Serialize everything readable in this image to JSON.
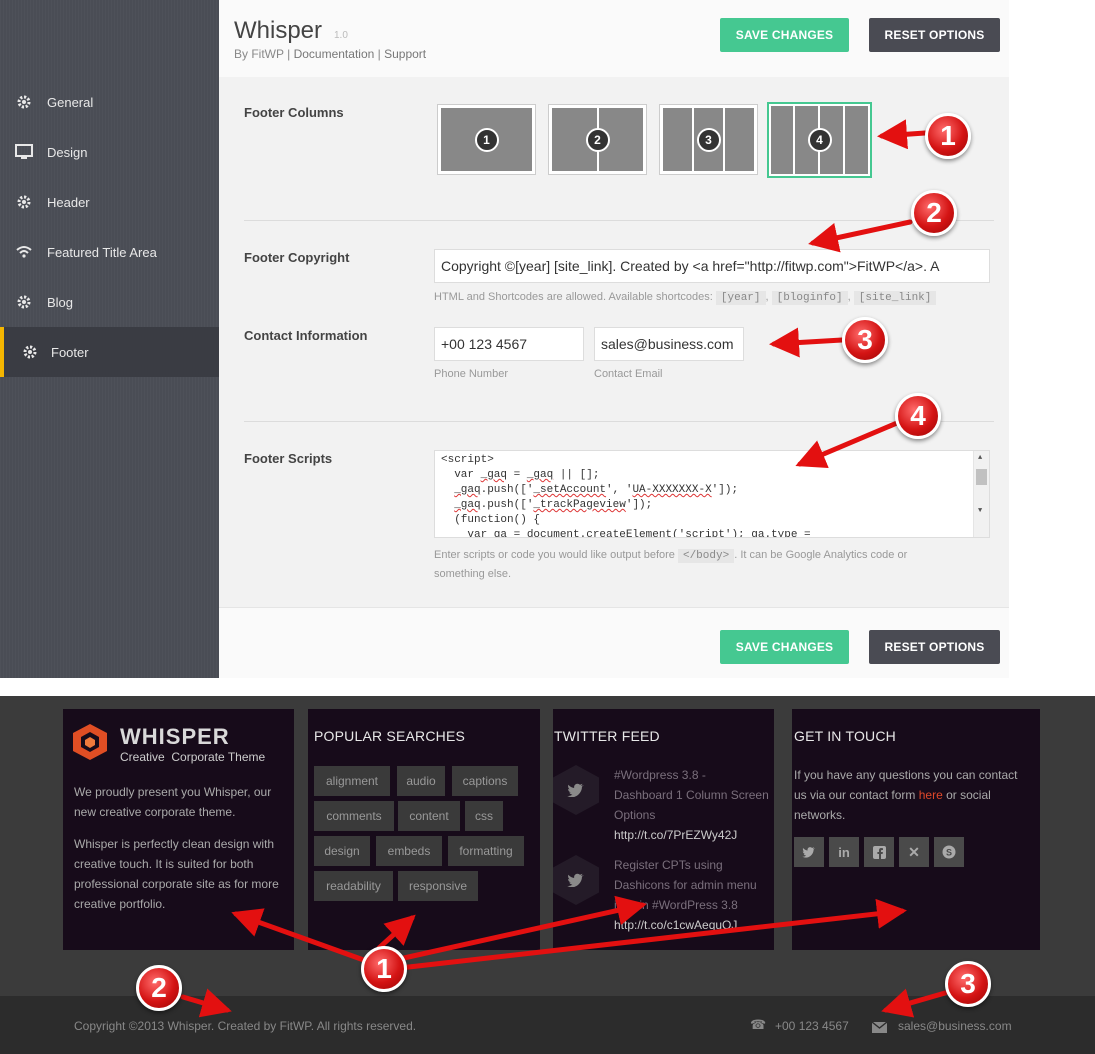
{
  "admin": {
    "title": "Whisper",
    "version": "1.0",
    "by": "By FitWP",
    "links": [
      "Documentation",
      "Support"
    ],
    "save_label": "SAVE CHANGES",
    "reset_label": "RESET OPTIONS",
    "sidebar": [
      {
        "label": "General",
        "icon": "gear-icon"
      },
      {
        "label": "Design",
        "icon": "monitor-icon"
      },
      {
        "label": "Header",
        "icon": "gear-icon"
      },
      {
        "label": "Featured Title Area",
        "icon": "wifi-icon"
      },
      {
        "label": "Blog",
        "icon": "gear-icon"
      },
      {
        "label": "Footer",
        "icon": "gear-icon",
        "active": true
      }
    ],
    "footer_columns": {
      "label": "Footer Columns",
      "options": [
        "1",
        "2",
        "3",
        "4"
      ],
      "selected": "4"
    },
    "footer_copyright": {
      "label": "Footer Copyright",
      "value": "Copyright ©[year] [site_link]. Created by <a href=\"http://fitwp.com\">FitWP</a>. A",
      "hint": "HTML and Shortcodes are allowed. Available shortcodes:",
      "shortcodes": [
        "[year]",
        "[bloginfo]",
        "[site_link]"
      ]
    },
    "contact": {
      "label": "Contact Information",
      "phone_value": "+00 123 4567",
      "phone_label": "Phone Number",
      "email_value": "sales@business.com",
      "email_label": "Contact Email"
    },
    "footer_scripts": {
      "label": "Footer Scripts",
      "lines": [
        "<script>",
        "  var _gaq = _gaq || [];",
        "  _gaq.push(['_setAccount', 'UA-XXXXXXX-X']);",
        "  _gaq.push(['_trackPageview']);",
        "  (function() {",
        "    var ga = document.createElement('script'); ga.type ="
      ],
      "hint_before": "Enter scripts or code you would like output before",
      "hint_tag": "</body>",
      "hint_after": ". It can be Google Analytics code or",
      "hint_line2": "something else."
    }
  },
  "site_footer": {
    "brand": "WHISPER",
    "tagline": "Creative  Corporate Theme",
    "about_1": "We proudly present you Whisper, our new creative corporate theme.",
    "about_2": "Whisper is perfectly clean design with creative touch. It is suited for both professional corporate site as for more creative portfolio.",
    "popular_title": "POPULAR SEARCHES",
    "tags": [
      "alignment",
      "audio",
      "captions",
      "comments",
      "content",
      "css",
      "design",
      "embeds",
      "formatting",
      "readability",
      "responsive"
    ],
    "twitter_title": "TWITTER FEED",
    "tweets": [
      {
        "lines": [
          "#Wordpress 3.8 -",
          "Dashboard 1 Column Screen",
          "Options"
        ],
        "link": "http://t.co/7PrEZWy42J"
      },
      {
        "lines": [
          "Register CPTs using",
          "Dashicons for admin menu",
          "icon in #WordPress 3.8"
        ],
        "link": "http://t.co/c1cwAequQJ"
      }
    ],
    "contact_title": "GET IN TOUCH",
    "contact_text_1": "If you have any questions you can contact us via our contact form",
    "contact_link": "here",
    "contact_text_2": "or social networks.",
    "socials": [
      "twitter-icon",
      "linkedin-icon",
      "facebook-icon",
      "xing-icon",
      "skype-icon"
    ],
    "copyright": "Copyright ©2013 Whisper. Created by FitWP. All rights reserved.",
    "phone": "+00 123 4567",
    "email": "sales@business.com"
  },
  "annotations": [
    "1",
    "2",
    "3",
    "4",
    "1",
    "2",
    "3"
  ],
  "colors": {
    "accent": "#45c891",
    "sidebar_active": "#f5b600",
    "annotation": "#d41414"
  }
}
